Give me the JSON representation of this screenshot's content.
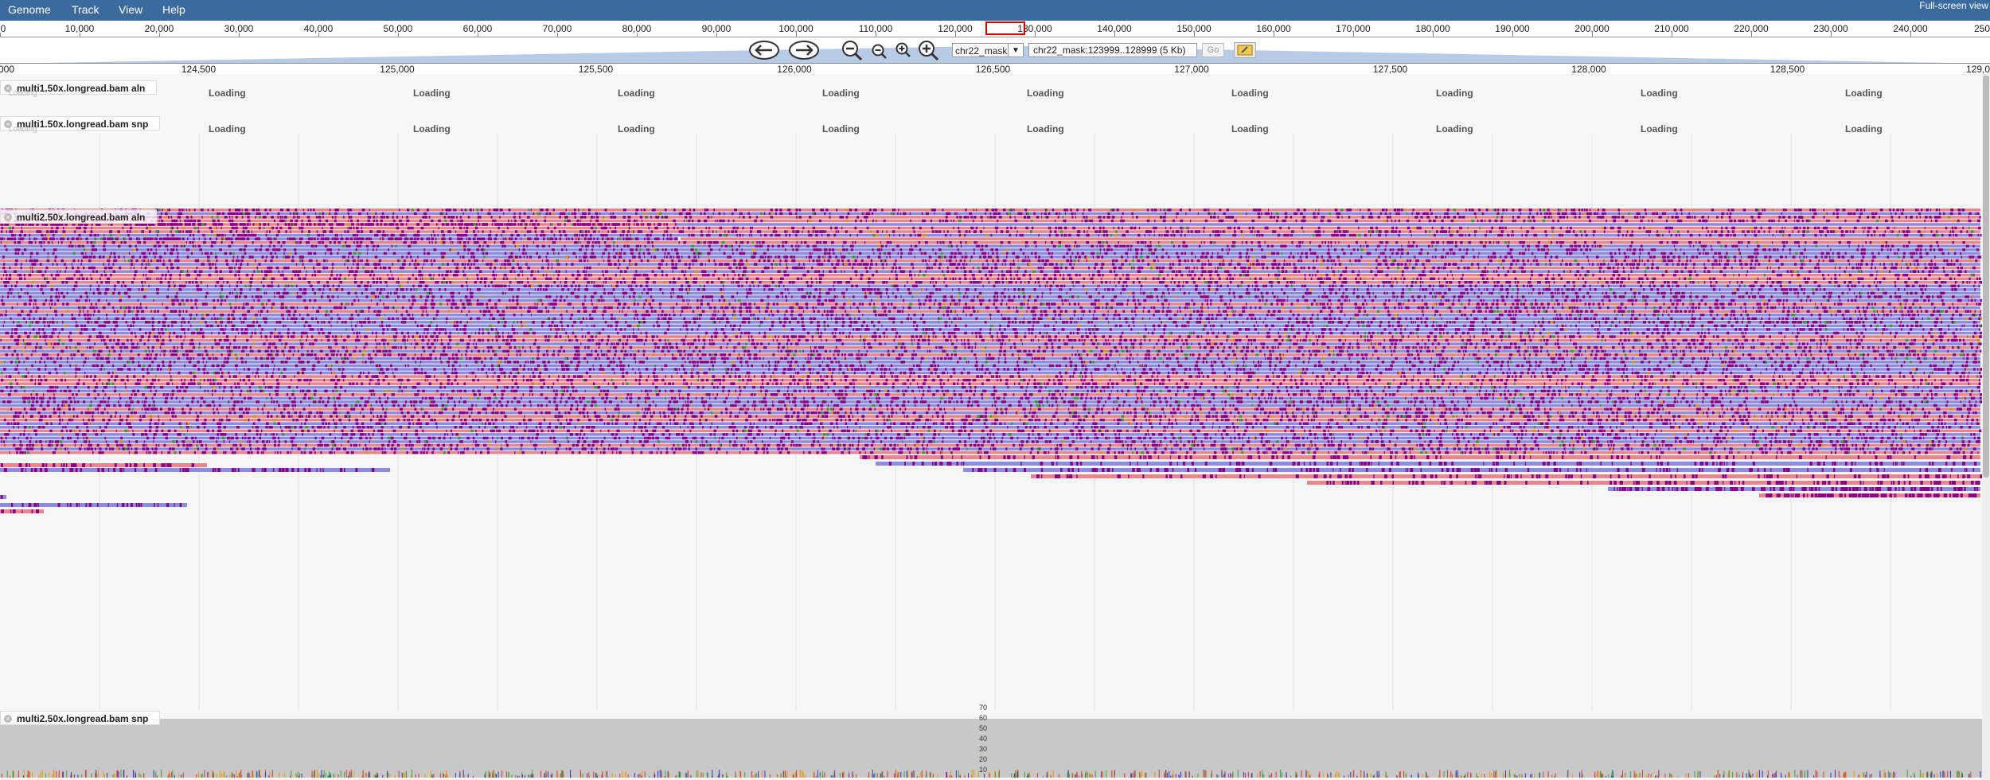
{
  "menu": {
    "genome": "Genome",
    "track": "Track",
    "view": "View",
    "help": "Help"
  },
  "fullscreen_label": "Full-screen view",
  "overview_ticks": [
    "0",
    "10,000",
    "20,000",
    "30,000",
    "40,000",
    "50,000",
    "60,000",
    "70,000",
    "80,000",
    "90,000",
    "100,000",
    "110,000",
    "120,000",
    "130,000",
    "140,000",
    "150,000",
    "160,000",
    "170,000",
    "180,000",
    "190,000",
    "200,000",
    "210,000",
    "220,000",
    "230,000",
    "240,000",
    "250"
  ],
  "navigation": {
    "chrom_select": "chr22_mask",
    "location": "chr22_mask:123999..128999 (5 Kb)",
    "go_label": "Go",
    "icons": [
      "pan-left-icon",
      "pan-right-icon",
      "zoom-out-large-icon",
      "zoom-out-icon",
      "zoom-in-icon",
      "zoom-in-large-icon",
      "highlight-icon"
    ]
  },
  "ruler_ticks": [
    "000",
    "124,500",
    "125,000",
    "125,500",
    "126,000",
    "126,500",
    "127,000",
    "127,500",
    "128,000",
    "128,500",
    "129,0"
  ],
  "tracks": [
    {
      "label": "multi1.50x.longread.bam aln",
      "sublabel": "Loading",
      "loading_text": "Loading"
    },
    {
      "label": "multi1.50x.longread.bam snp",
      "sublabel": "Loading",
      "loading_text": "Loading"
    },
    {
      "label": "multi2.50x.longread.bam aln"
    },
    {
      "label": "multi2.50x.longread.bam snp"
    }
  ],
  "coverage_axis": [
    "70",
    "60",
    "50",
    "40",
    "30",
    "20",
    "10"
  ],
  "colors": {
    "menubar": "#3b6a9e",
    "read_forward": "#e8868e",
    "read_reverse": "#8c8ce0",
    "mismatch": "#8b008b",
    "coverage": "#c8c8c8"
  }
}
